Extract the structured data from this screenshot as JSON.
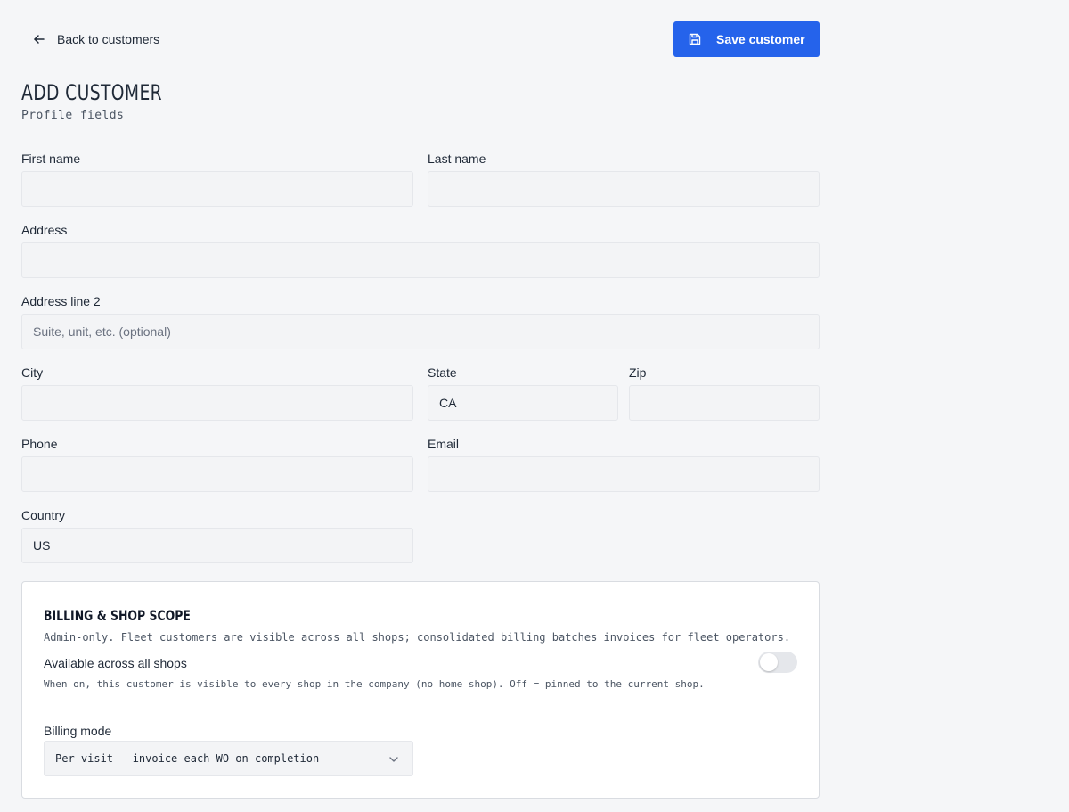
{
  "header": {
    "back_label": "Back to customers",
    "save_label": "Save customer",
    "title": "ADD CUSTOMER",
    "subtitle": "Profile fields"
  },
  "form": {
    "first_name": {
      "label": "First name",
      "value": "",
      "placeholder": ""
    },
    "last_name": {
      "label": "Last name",
      "value": "",
      "placeholder": ""
    },
    "address": {
      "label": "Address",
      "value": "",
      "placeholder": ""
    },
    "address2": {
      "label": "Address line 2",
      "value": "",
      "placeholder": "Suite, unit, etc. (optional)"
    },
    "city": {
      "label": "City",
      "value": "",
      "placeholder": ""
    },
    "state": {
      "label": "State",
      "value": "CA",
      "placeholder": ""
    },
    "zip": {
      "label": "Zip",
      "value": "",
      "placeholder": ""
    },
    "phone": {
      "label": "Phone",
      "value": "",
      "placeholder": ""
    },
    "email": {
      "label": "Email",
      "value": "",
      "placeholder": ""
    },
    "country": {
      "label": "Country",
      "value": "US",
      "placeholder": ""
    }
  },
  "billing": {
    "title": "BILLING & SHOP SCOPE",
    "description": "Admin-only. Fleet customers are visible across all shops; consolidated billing batches invoices for fleet operators.",
    "toggle_label": "Available across all shops",
    "toggle_help": "When on, this customer is visible to every shop in the company (no home shop). Off = pinned to the current shop.",
    "toggle_on": false,
    "mode_label": "Billing mode",
    "mode_value": "Per visit — invoice each WO on completion"
  },
  "colors": {
    "accent": "#2563eb",
    "background": "#f5f6f8",
    "input_bg": "#f3f4f6"
  },
  "icons": {
    "back": "arrow-left-icon",
    "save": "floppy-disk-icon",
    "select": "chevron-down-icon"
  }
}
